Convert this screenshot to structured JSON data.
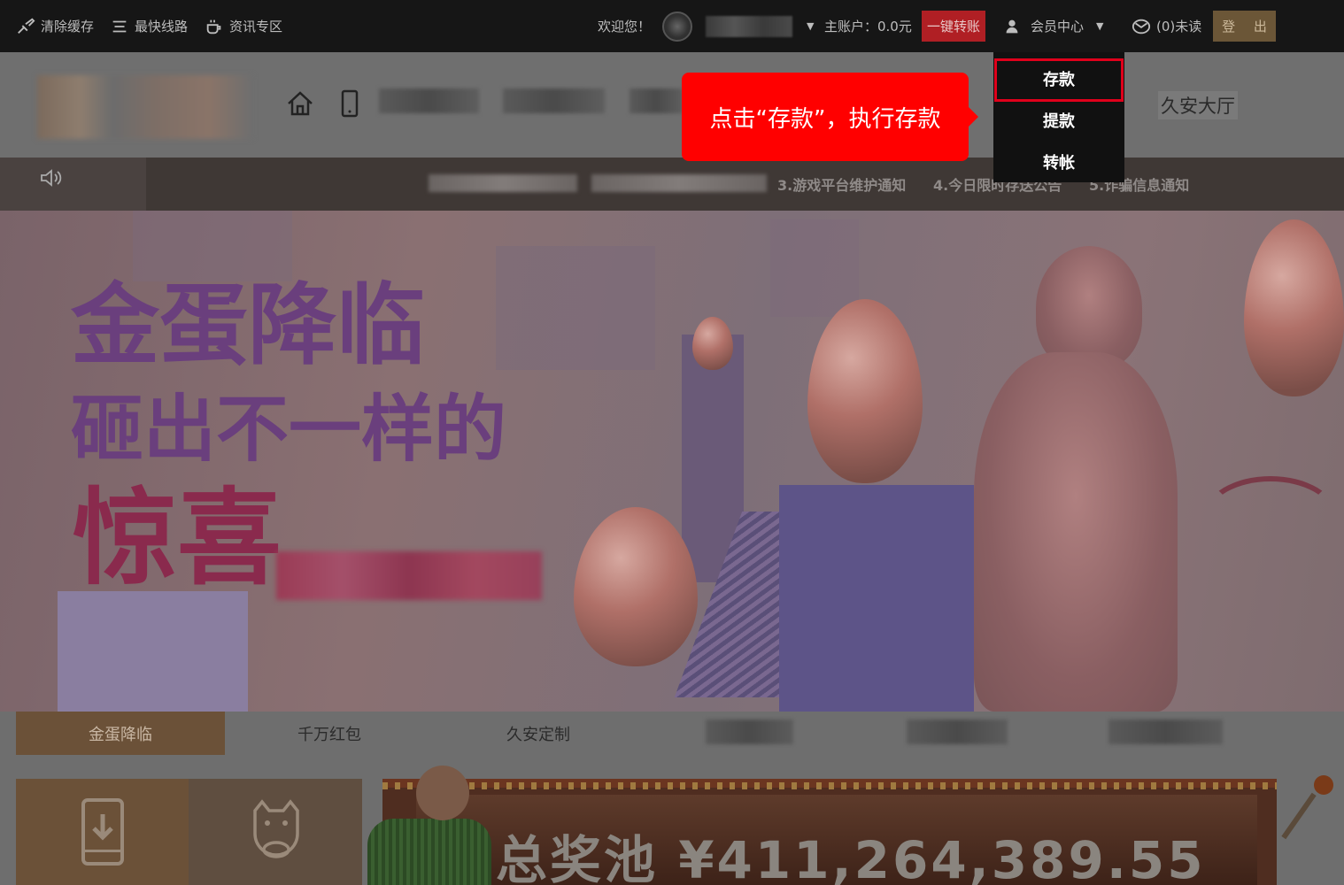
{
  "topbar": {
    "clear_cache": "清除缓存",
    "fastest_route": "最快线路",
    "news": "资讯专区",
    "welcome": "欢迎您！",
    "account": "主账户：0.0元",
    "one_click_transfer": "一键转账",
    "member_center": "会员中心",
    "messages": "(0)未读",
    "logout": "登 出"
  },
  "nav": {
    "right_label": "久安大厅"
  },
  "notice": {
    "item3": "3.游戏平台维护通知",
    "item4": "4.今日限时存送公告",
    "item5": "5.诈骗信息通知"
  },
  "banner": {
    "line1": "金蛋降临",
    "line2": "砸出不一样的",
    "line3": "惊喜"
  },
  "tabs": [
    {
      "label": "金蛋降临",
      "active": true
    },
    {
      "label": "千万红包",
      "active": false
    },
    {
      "label": "久安定制",
      "active": false
    }
  ],
  "jackpot": {
    "text": "总奖池 ¥411,264,389.55"
  },
  "dropdown": {
    "items": [
      {
        "label": "存款"
      },
      {
        "label": "提款"
      },
      {
        "label": "转帐"
      }
    ]
  },
  "callout": {
    "text": "点击“存款”，执行存款"
  },
  "colors": {
    "callout_bg": "#ff0000",
    "highlight_border": "#e0001b",
    "transfer_btn": "#b01f24",
    "logout_btn": "#6b5637",
    "active_tab": "#6b5138"
  }
}
